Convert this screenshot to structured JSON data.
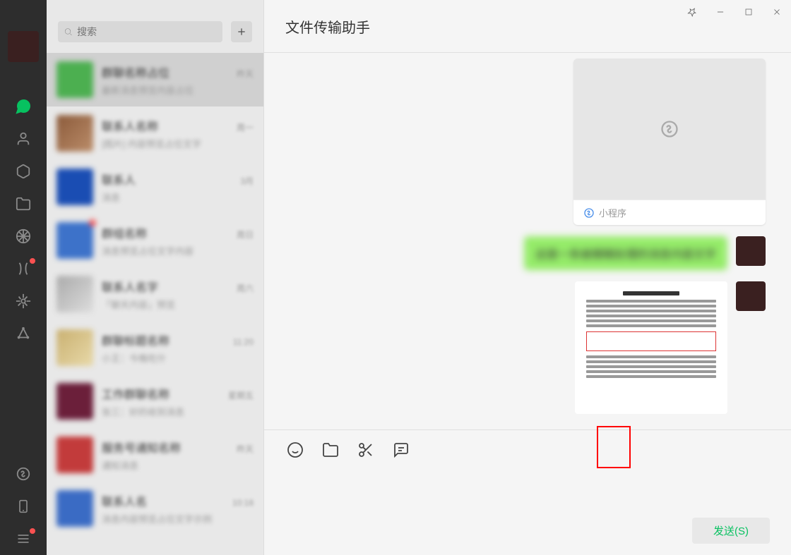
{
  "header": {
    "title": "文件传输助手"
  },
  "search": {
    "placeholder": "搜索"
  },
  "nav": {
    "items": [
      "chat",
      "contacts",
      "collect",
      "files",
      "moments",
      "channels",
      "miniprogram",
      "more"
    ]
  },
  "chats": [
    {
      "name": "群聊名称占位",
      "time": "昨天",
      "preview": "最新消息预览内容占位",
      "avatar": "av0",
      "selected": true,
      "badge": false
    },
    {
      "name": "联系人名称",
      "time": "周一",
      "preview": "[图片] 内容预览占位文字",
      "avatar": "av1",
      "badge": false
    },
    {
      "name": "联系人",
      "time": "3月",
      "preview": "消息",
      "avatar": "av2",
      "badge": false
    },
    {
      "name": "群组名称",
      "time": "周日",
      "preview": "消息预览占位文字内容",
      "avatar": "av3",
      "badge": true
    },
    {
      "name": "联系人名字",
      "time": "周六",
      "preview": "「聊天内容」预览",
      "avatar": "av4",
      "badge": false
    },
    {
      "name": "群聊标题名称",
      "time": "11:20",
      "preview": "小王：今晚吃什",
      "avatar": "av5",
      "badge": false
    },
    {
      "name": "工作群聊名称",
      "time": "星期五",
      "preview": "张三：好的收到消息",
      "avatar": "av6",
      "badge": false
    },
    {
      "name": "服务号通知名称",
      "time": "昨天",
      "preview": "通知消息",
      "avatar": "av7",
      "badge": false
    },
    {
      "name": "联系人名",
      "time": "10:18",
      "preview": "消息内容预览占位文字示例",
      "avatar": "av8",
      "badge": false
    }
  ],
  "messages": {
    "miniprogram_label": "小程序",
    "text_content": "这是一条被模糊处理的消息内容文字"
  },
  "composer": {
    "send_label": "发送(S)"
  }
}
